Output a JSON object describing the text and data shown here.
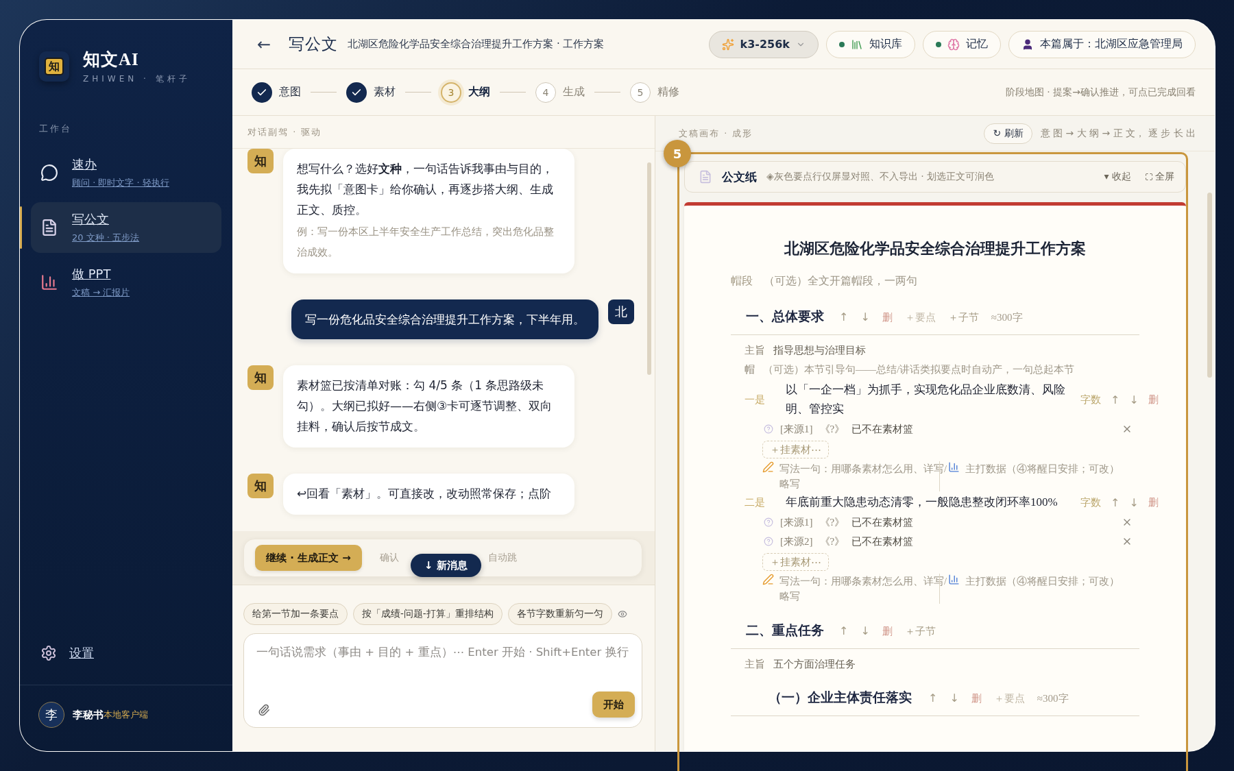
{
  "sidebar": {
    "logo_mark": "知",
    "brand": "知文AI",
    "tagline": "ZHIWEN · 笔杆子",
    "section_label": "工作台",
    "nav": [
      {
        "kind": "quick",
        "title": "速办",
        "subtitle": "顾问 · 即时文字 · 轻执行",
        "selected": false
      },
      {
        "kind": "document",
        "title": "写公文",
        "subtitle": "20 文种 · 五步法",
        "selected": true
      },
      {
        "kind": "slides",
        "title": "做 PPT",
        "subtitle": "文稿 → 汇报片",
        "selected": false
      }
    ],
    "settings": "设置",
    "user": {
      "avatar": "李",
      "name": "李秘书",
      "client": "本地客户端"
    }
  },
  "header": {
    "back": "←",
    "title": "写公文",
    "subtitle": "北湖区危险化学品安全综合治理提升工作方案 · 工作方案",
    "model": "k3-256k",
    "toggles": [
      {
        "kind": "library",
        "label": "知识库",
        "on": true
      },
      {
        "kind": "memory",
        "label": "记忆",
        "on": true
      }
    ],
    "owner": "本篇属于：北湖区应急管理局"
  },
  "stepper": {
    "steps": [
      {
        "label": "意图",
        "done": true,
        "selected": false
      },
      {
        "label": "素材",
        "done": true,
        "selected": false
      },
      {
        "number": "3",
        "label": "大纲",
        "done": false,
        "selected": true
      },
      {
        "number": "4",
        "label": "生成",
        "done": false,
        "selected": false
      },
      {
        "number": "5",
        "label": "精修",
        "done": false,
        "selected": false
      }
    ],
    "hint": "阶段地图 · 提案→确认推进，可点已完成回看"
  },
  "chat": {
    "header": "对话副驾 · 驱动",
    "messages": [
      {
        "kind": "assistant",
        "avatar": "知",
        "text": "想写什么？选好**文种**，一句话告诉我事由与目的，我先拟「意图卡」给你确认，再逐步搭大纲、生成正文、质控。",
        "example": "例：写一份本区上半年安全生产工作总结，突出危化品整治成效。"
      },
      {
        "kind": "user",
        "avatar": "北",
        "text": "写一份危化品安全综合治理提升工作方案，下半年用。"
      },
      {
        "kind": "assistant",
        "avatar": "知",
        "text": "素材篮已按清单对账：勾 4/5 条（1 条思路级未勾）。大纲已拟好——右侧③卡可逐节调整、双向挂料，确认后按节成文。"
      },
      {
        "kind": "assistant",
        "avatar": "知",
        "text": "↩回看「素材」。可直接改，改动照常保存；点阶"
      }
    ],
    "continue_button": "继续 · 生成正文 →",
    "hint_parts": [
      "确认",
      "自动跳"
    ],
    "new_message": "↓ 新消息",
    "suggestions": [
      "给第一节加一条要点",
      "按「成绩-问题-打算」重排结构",
      "各节字数重新匀一匀"
    ],
    "input_placeholder": "一句话说需求（事由 + 目的 + 重点）⋯ Enter 开始 · Shift+Enter 换行",
    "send": "开始"
  },
  "canvas": {
    "header": "文稿画布 · 成形",
    "refresh": "↻ 刷新",
    "flow": "意 图 → 大 纲 → 正 文， 逐 步 长 出",
    "tour_step": "5",
    "paper_bar": {
      "title": "公文纸",
      "note": "◈灰色要点行仅屏显对照、不入导出 · 划选正文可润色",
      "collapse": "▾ 收起",
      "fullscreen": "全屏"
    },
    "document": {
      "title": "北湖区危险化学品安全综合治理提升工作方案",
      "lead": {
        "label": "帽段",
        "text": "（可选）全文开篇帽段，一两句"
      },
      "sections": [
        {
          "title": "一、总体要求",
          "actions": [
            {
              "label": "↑",
              "kind": "move"
            },
            {
              "label": "↓",
              "kind": "move"
            },
            {
              "label": "删",
              "kind": "delete"
            },
            {
              "label": "＋要点",
              "kind": "add",
              "disabled": true
            },
            {
              "label": "＋子节",
              "kind": "add",
              "disabled": false
            },
            {
              "label": "≈300字",
              "kind": "estimate"
            }
          ],
          "gist": {
            "label": "主旨",
            "text": "指导思想与治理目标"
          },
          "intro": {
            "label": "帽",
            "text": "（可选）本节引导句——总结/讲话类拟要点时自动产，一句总起本节"
          },
          "points": [
            {
              "label": "一是",
              "text": "以「一企一档」为抓手，实现危化品企业底数清、风险明、管控实",
              "actions": [
                {
                  "label": "字数",
                  "kind": "count"
                },
                {
                  "label": "↑",
                  "kind": "move"
                },
                {
                  "label": "↓",
                  "kind": "move"
                },
                {
                  "label": "删",
                  "kind": "delete"
                }
              ],
              "sources": [
                {
                  "ref": "[来源1]",
                  "title": "《?》",
                  "note": "已不在素材篮"
                }
              ],
              "attach": "＋挂素材⋯",
              "tips": [
                {
                  "kind": "method",
                  "text": "写法一句：用哪条素材怎么用、详写/略写"
                },
                {
                  "kind": "data",
                  "text": "主打数据（④将醒日安排；可改）"
                }
              ]
            },
            {
              "label": "二是",
              "text": "年底前重大隐患动态清零，一般隐患整改闭环率100%",
              "actions": [
                {
                  "label": "字数",
                  "kind": "count"
                },
                {
                  "label": "↑",
                  "kind": "move"
                },
                {
                  "label": "↓",
                  "kind": "move"
                },
                {
                  "label": "删",
                  "kind": "delete"
                }
              ],
              "sources": [
                {
                  "ref": "[来源1]",
                  "title": "《?》",
                  "note": "已不在素材篮"
                },
                {
                  "ref": "[来源2]",
                  "title": "《?》",
                  "note": "已不在素材篮"
                }
              ],
              "attach": "＋挂素材⋯",
              "tips": [
                {
                  "kind": "method",
                  "text": "写法一句：用哪条素材怎么用、详写/略写"
                },
                {
                  "kind": "data",
                  "text": "主打数据（④将醒日安排；可改）"
                }
              ]
            }
          ]
        },
        {
          "title": "二、重点任务",
          "actions": [
            {
              "label": "↑",
              "kind": "move"
            },
            {
              "label": "↓",
              "kind": "move"
            },
            {
              "label": "删",
              "kind": "delete"
            },
            {
              "label": "＋子节",
              "kind": "add",
              "disabled": false
            }
          ],
          "gist": {
            "label": "主旨",
            "text": "五个方面治理任务"
          },
          "children": [
            {
              "title": "（一）企业主体责任落实",
              "actions": [
                {
                  "label": "↑",
                  "kind": "move"
                },
                {
                  "label": "↓",
                  "kind": "move"
                },
                {
                  "label": "删",
                  "kind": "delete"
                },
                {
                  "label": "＋要点",
                  "kind": "add",
                  "disabled": true
                },
                {
                  "label": "≈300字",
                  "kind": "estimate"
                }
              ]
            }
          ]
        }
      ]
    }
  }
}
